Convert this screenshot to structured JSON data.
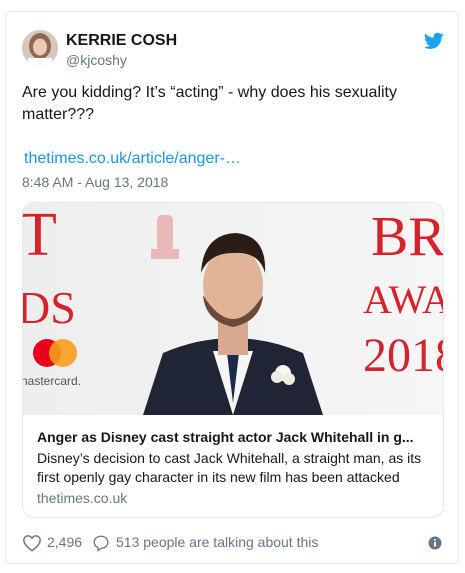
{
  "user": {
    "display_name": "KERRIE COSH",
    "handle": "@kjcoshy"
  },
  "tweet": {
    "text": "Are you kidding? It’s “acting” - why does his sexuality matter???",
    "link": "thetimes.co.uk/article/anger-…",
    "timestamp": "8:48 AM - Aug 13, 2018"
  },
  "card": {
    "title": "Anger as Disney cast straight actor Jack Whitehall in g...",
    "description": "Disney’s decision to cast Jack Whitehall, a straight man, as its first openly gay character in its new film has been attacked",
    "domain": "thetimes.co.uk",
    "backdrop_left_text": [
      "T",
      "DS",
      "nastercard."
    ],
    "backdrop_right_text": [
      "BR",
      "AWA",
      "2018"
    ]
  },
  "actions": {
    "like_count": "2,496",
    "talking_text": "513 people are talking about this"
  },
  "colors": {
    "twitter_blue": "#1da1f2",
    "link_blue": "#1b95e0",
    "muted": "#657786",
    "border": "#e1e8ed",
    "brit_red": "#d4232b"
  },
  "icons": {
    "logo": "twitter-bird-icon",
    "like": "heart-icon",
    "reply": "reply-bubble-icon",
    "info": "info-icon"
  }
}
